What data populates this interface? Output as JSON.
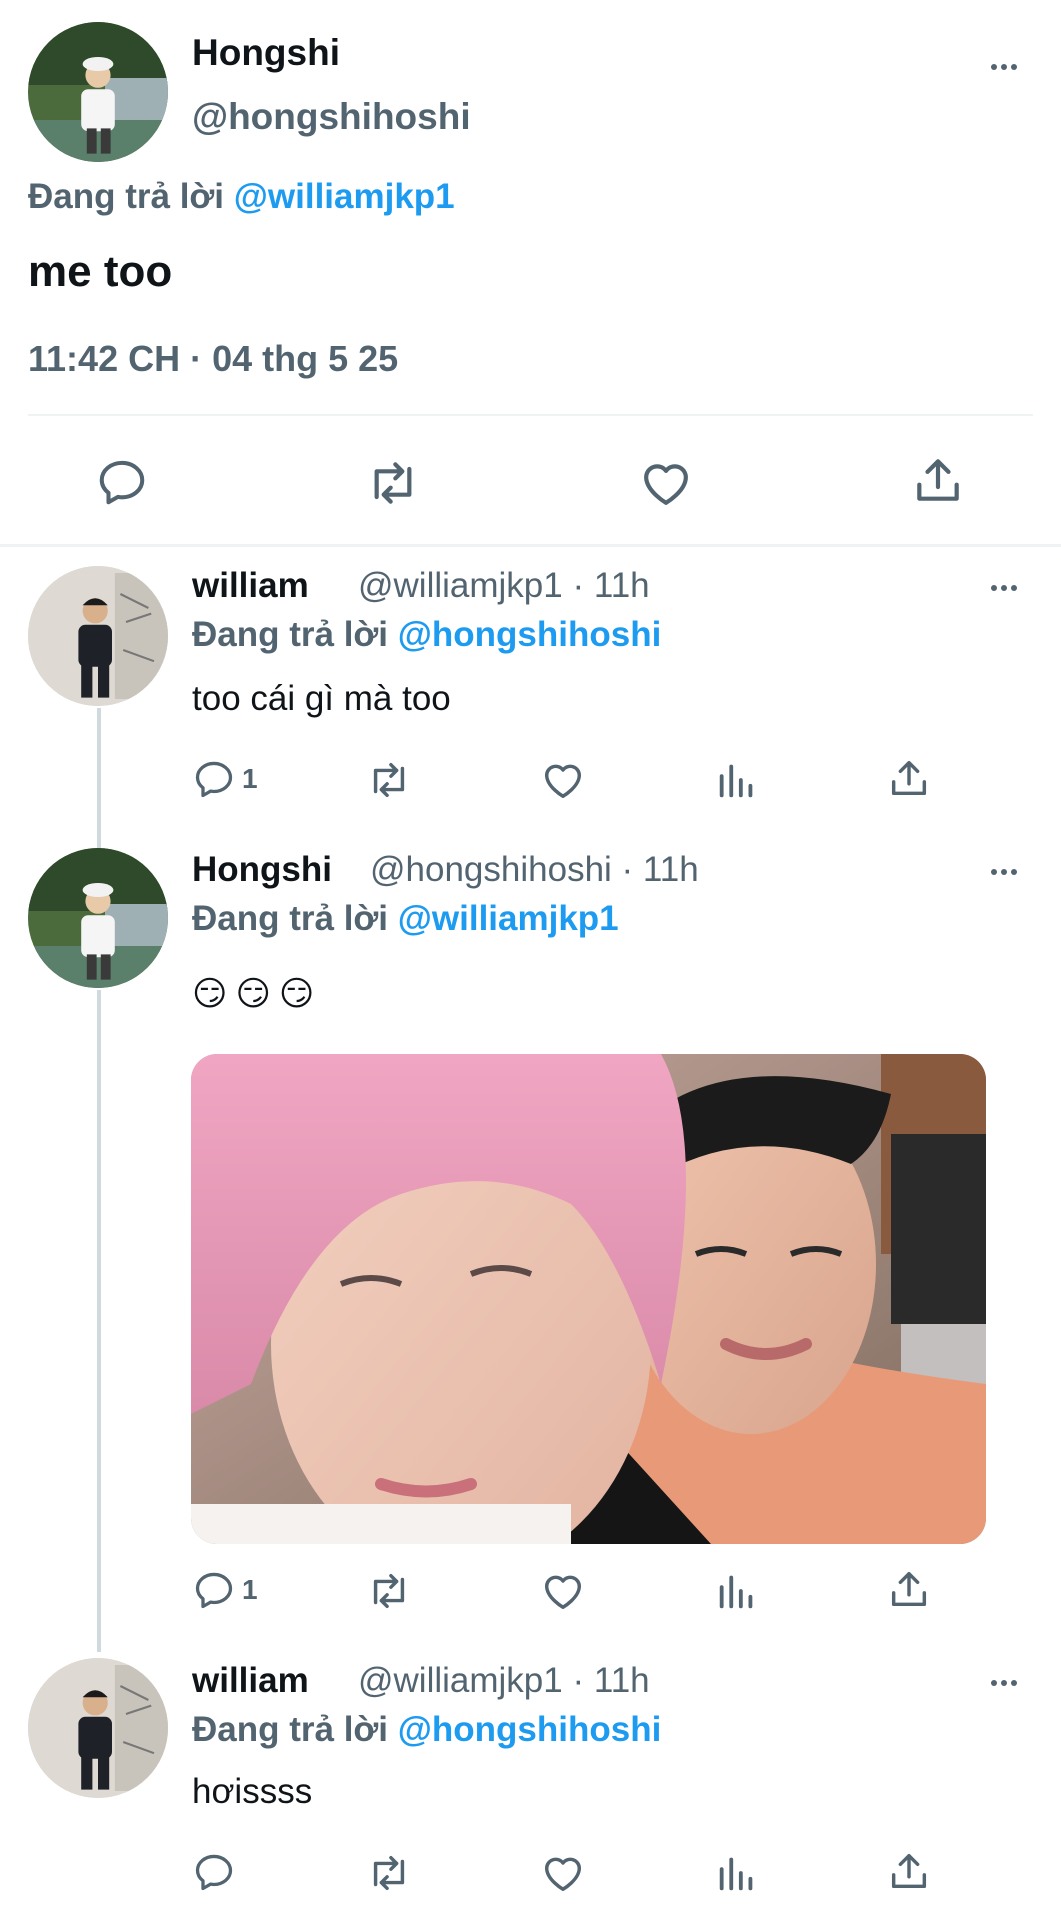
{
  "main_tweet": {
    "display_name": "Hongshi",
    "handle": "@hongshihoshi",
    "replying_prefix": "Đang trả lời",
    "replying_to": "@williamjkp1",
    "text": "me too",
    "timestamp": "11:42 CH · 04 thg 5 25",
    "more_icon": "more-icon",
    "actions": [
      "reply-icon",
      "retweet-icon",
      "like-icon",
      "share-icon"
    ]
  },
  "replies": [
    {
      "display_name": "william",
      "handle": "@williamjkp1 · 11h",
      "replying_prefix": "Đang trả lời",
      "replying_to": "@hongshihoshi",
      "text": "too cái gì mà too",
      "reply_count": "1"
    },
    {
      "display_name": "Hongshi",
      "handle": "@hongshihoshi · 11h",
      "replying_prefix": "Đang trả lời",
      "replying_to": "@williamjkp1",
      "text": "😏😏😏",
      "reply_count": "1",
      "has_photo": true
    },
    {
      "display_name": "william",
      "handle": "@williamjkp1 · 11h",
      "replying_prefix": "Đang trả lời",
      "replying_to": "@hongshihoshi",
      "text": "hơissss",
      "reply_count": ""
    }
  ],
  "colors": {
    "accent": "#1d9bf0",
    "muted": "#536471",
    "text": "#0f1419",
    "divider": "#eff3f4"
  }
}
